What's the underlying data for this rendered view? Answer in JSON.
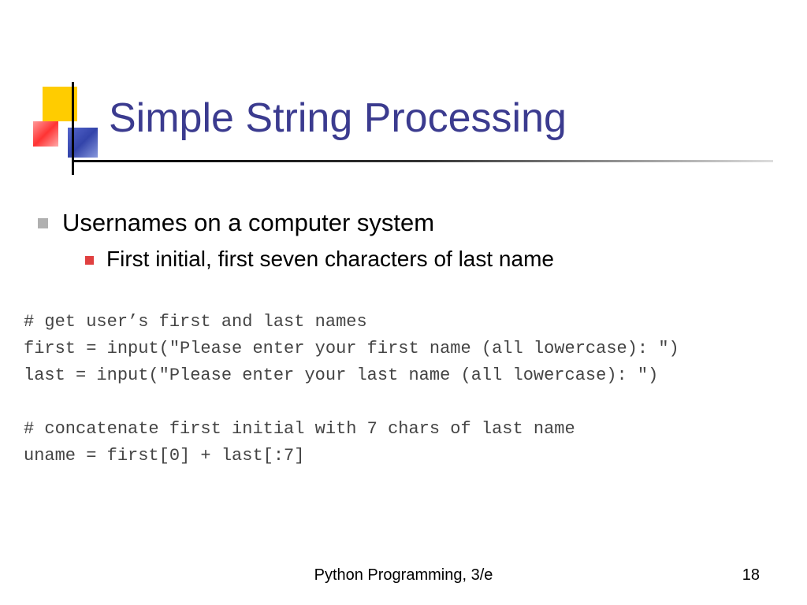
{
  "title": "Simple String Processing",
  "bullets": {
    "l1": "Usernames on a computer system",
    "l2": "First initial, first seven characters of last name"
  },
  "code": {
    "line1": "# get user’s first and last names",
    "line2": "first = input(\"Please enter your first name (all lowercase): \")",
    "line3": "last = input(\"Please enter your last name (all lowercase): \")",
    "line4": "# concatenate first initial with 7 chars of last name",
    "line5": "uname = first[0] + last[:7]"
  },
  "footer": {
    "text": "Python Programming, 3/e",
    "page": "18"
  }
}
